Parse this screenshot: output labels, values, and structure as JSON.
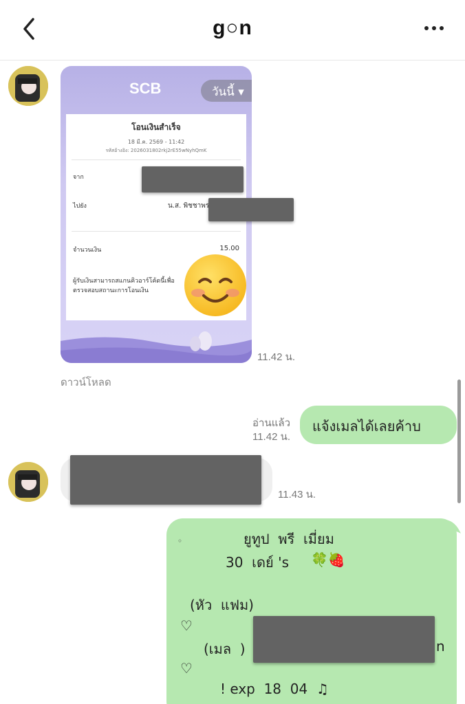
{
  "header": {
    "title": "g○n",
    "back_icon": "chevron-left-icon",
    "more_icon": "more-horizontal-icon"
  },
  "receipt": {
    "bank": "SCB",
    "date_pill": "วันนี้ ▾",
    "status": "โอนเงินสำเร็จ",
    "datetime": "18 มี.ค. 2569 - 11:42",
    "ref": "รหัสอ้างอิง: 2026031802rkj2rE55wNyhQmK",
    "from_label": "จาก",
    "to_label": "ไปยัง",
    "to_name": "น.ส. พิชชาพร",
    "amount_label": "จำนวนเงิน",
    "amount": "15.00",
    "note": "ผู้รับเงินสามารถสแกนคิวอาร์โค้ดนี้เพื่อตรวจสอบสถานะการโอนเงิน"
  },
  "messages": {
    "receipt_time": "11.42 น.",
    "download": "ดาวน์โหลด",
    "read_status": "อ่านแล้ว",
    "sent_time": "11.42 น.",
    "sent_text": "แจ้งเมลได้เลยค้าบ",
    "gray_time": "11.43 น.",
    "big_lines": [
      "ยูทูป  พรี  เมี่ยม",
      "30  เดย์ 's",
      "(หัว  แฟม)",
      "♡",
      "(เมล  )",
      "♡",
      "! exp  18  04  ♫"
    ],
    "big_emoji": "🍀🍓",
    "mail_suffix": "n",
    "small_dot": "◦"
  },
  "colors": {
    "green_bubble": "#b6e8b0",
    "gray_bubble": "#efefef",
    "redaction": "#636363"
  }
}
